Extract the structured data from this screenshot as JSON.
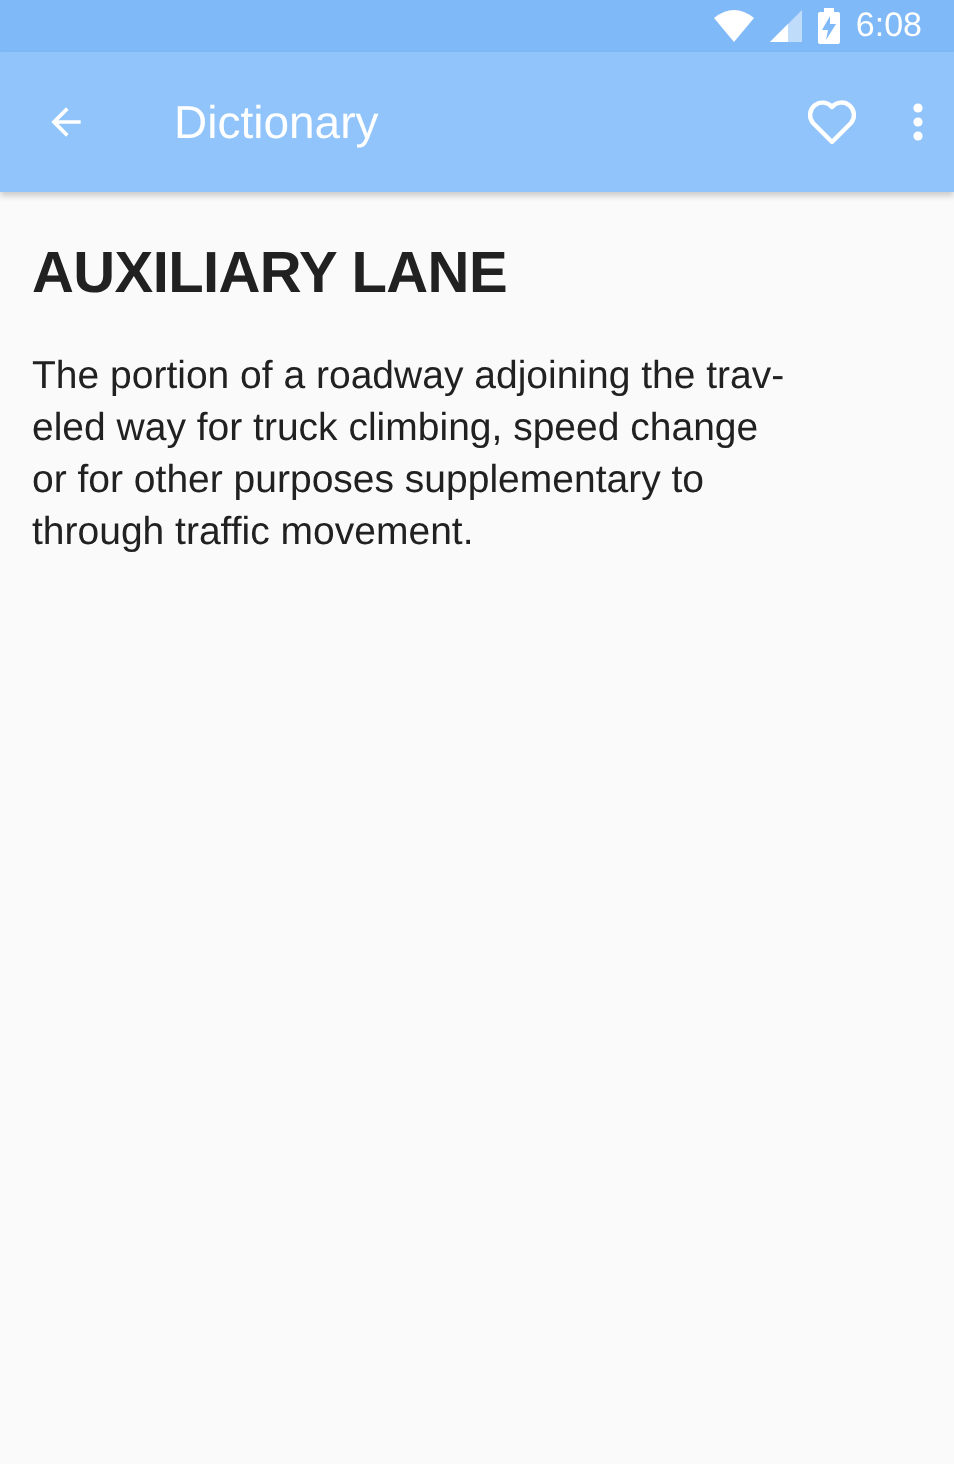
{
  "status_bar": {
    "time": "6:08"
  },
  "app_bar": {
    "title": "Dictionary",
    "favorite": false
  },
  "entry": {
    "term": "AUXILIARY LANE",
    "definition_lines": [
      "The portion of a roadway adjoining the trav-",
      "eled way for truck climbing, speed change",
      "or for other purposes supplementary to",
      "through traffic movement."
    ]
  }
}
